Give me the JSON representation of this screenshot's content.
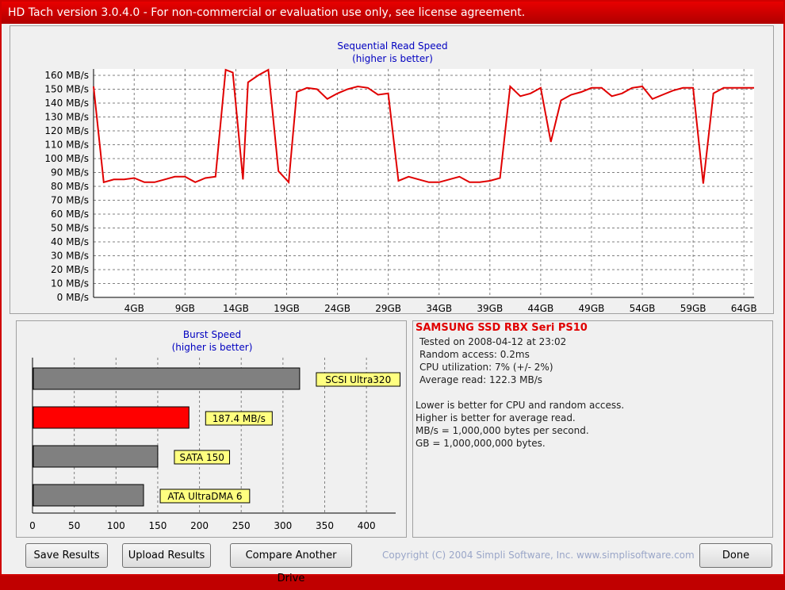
{
  "window": {
    "title": "HD Tach version 3.0.4.0  - For non-commercial or evaluation use only, see license agreement."
  },
  "read_chart": {
    "title": "Sequential Read Speed",
    "subtitle": "(higher is better)"
  },
  "burst_chart": {
    "title": "Burst Speed",
    "subtitle": "(higher is better)"
  },
  "info": {
    "drive_name": "SAMSUNG SSD RBX Seri PS10",
    "tested_on": "Tested on 2008-04-12 at 23:02",
    "random_access": "Random access: 0.2ms",
    "cpu_utilization": "CPU utilization: 7% (+/- 2%)",
    "average_read": "Average read: 122.3 MB/s",
    "notes": [
      "Lower is better for CPU and random access.",
      "Higher is better for average read.",
      "MB/s = 1,000,000 bytes per second.",
      "GB = 1,000,000,000 bytes."
    ]
  },
  "buttons": {
    "save": "Save Results",
    "upload": "Upload Results",
    "compare": "Compare Another Drive",
    "done": "Done"
  },
  "copyright": "Copyright (C) 2004 Simpli Software, Inc. www.simplisoftware.com",
  "colors": {
    "accent": "#e00000",
    "title_blue": "#0000c0",
    "label_yellow": "#ffff80",
    "bar_gray": "#808080"
  },
  "chart_data": [
    {
      "type": "line",
      "title": "Sequential Read Speed",
      "subtitle": "(higher is better)",
      "ylim": [
        0,
        160
      ],
      "yticks": [
        0,
        10,
        20,
        30,
        40,
        50,
        60,
        70,
        80,
        90,
        100,
        110,
        120,
        130,
        140,
        150,
        160
      ],
      "ytick_suffix": " MB/s",
      "xlim": [
        0,
        65
      ],
      "xticks": [
        "4GB",
        "9GB",
        "14GB",
        "19GB",
        "24GB",
        "29GB",
        "34GB",
        "39GB",
        "44GB",
        "49GB",
        "54GB",
        "59GB",
        "64GB"
      ],
      "xtick_values": [
        4,
        9,
        14,
        19,
        24,
        29,
        34,
        39,
        44,
        49,
        54,
        59,
        64
      ],
      "grid": true,
      "series": [
        {
          "color": "#e00000",
          "x": [
            0,
            1,
            2,
            3,
            4,
            5,
            6,
            7,
            8,
            9,
            10,
            11,
            12,
            13,
            13.7,
            14.7,
            15.2,
            16.2,
            17.2,
            18.2,
            19.2,
            20,
            21,
            22,
            23,
            24,
            25,
            26,
            27,
            28,
            29,
            30,
            31,
            32,
            33,
            34,
            35,
            36,
            37,
            38,
            39,
            40,
            41,
            42,
            43,
            44,
            45,
            46,
            47,
            48,
            49,
            50,
            51,
            52,
            53,
            54,
            55,
            56,
            57,
            58,
            59,
            60,
            61,
            62,
            63,
            64,
            65
          ],
          "y": [
            152,
            83,
            85,
            85,
            86,
            83,
            83,
            85,
            87,
            87,
            83,
            86,
            87,
            164,
            162,
            85,
            155,
            160,
            164,
            91,
            83,
            148,
            151,
            150,
            143,
            147,
            150,
            152,
            151,
            146,
            147,
            84,
            87,
            85,
            83,
            83,
            85,
            87,
            83,
            83,
            84,
            86,
            152,
            145,
            147,
            151,
            112,
            142,
            146,
            148,
            151,
            151,
            145,
            147,
            151,
            152,
            143,
            146,
            149,
            151,
            151,
            82,
            147,
            151,
            151,
            151,
            151
          ]
        }
      ]
    },
    {
      "type": "bar",
      "orientation": "horizontal",
      "title": "Burst Speed",
      "subtitle": "(higher is better)",
      "xlim": [
        0,
        435
      ],
      "xticks": [
        0,
        50,
        100,
        150,
        200,
        250,
        300,
        350,
        400
      ],
      "categories": [
        "SCSI Ultra320",
        "187.4 MB/s",
        "SATA 150",
        "ATA UltraDMA 6"
      ],
      "values": [
        320,
        187.4,
        150,
        133
      ],
      "colors": [
        "#808080",
        "#ff0000",
        "#808080",
        "#808080"
      ]
    }
  ]
}
